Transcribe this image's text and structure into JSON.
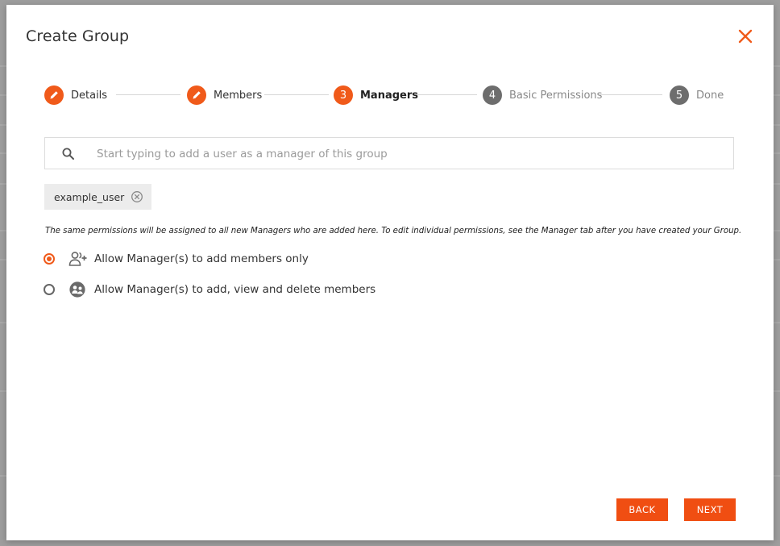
{
  "dialog": {
    "title": "Create Group",
    "close_icon": "close-icon"
  },
  "stepper": {
    "steps": [
      {
        "marker": "",
        "icon": "pencil-icon",
        "label": "Details",
        "state": "done"
      },
      {
        "marker": "",
        "icon": "pencil-icon",
        "label": "Members",
        "state": "done"
      },
      {
        "marker": "3",
        "label": "Managers",
        "state": "active"
      },
      {
        "marker": "4",
        "label": "Basic Permissions",
        "state": "pending"
      },
      {
        "marker": "5",
        "label": "Done",
        "state": "pending"
      }
    ]
  },
  "search": {
    "icon": "search-icon",
    "placeholder": "Start typing to add a user as a manager of this group",
    "value": ""
  },
  "selected_managers": [
    {
      "name": "example_user",
      "remove_icon": "remove-circle-icon"
    }
  ],
  "permissions": {
    "note": "The same permissions will be assigned to all new Managers who are added here. To edit individual permissions, see the Manager tab after you have created your Group.",
    "options": [
      {
        "label": "Allow Manager(s) to add members only",
        "icon": "add-person-icon",
        "selected": true
      },
      {
        "label": "Allow Manager(s) to add, view and delete members",
        "icon": "group-circle-icon",
        "selected": false
      }
    ]
  },
  "footer": {
    "back_label": "BACK",
    "next_label": "NEXT"
  },
  "colors": {
    "accent": "#f05a1a",
    "button": "#f04e12",
    "pending_step": "#6d6d6d"
  }
}
